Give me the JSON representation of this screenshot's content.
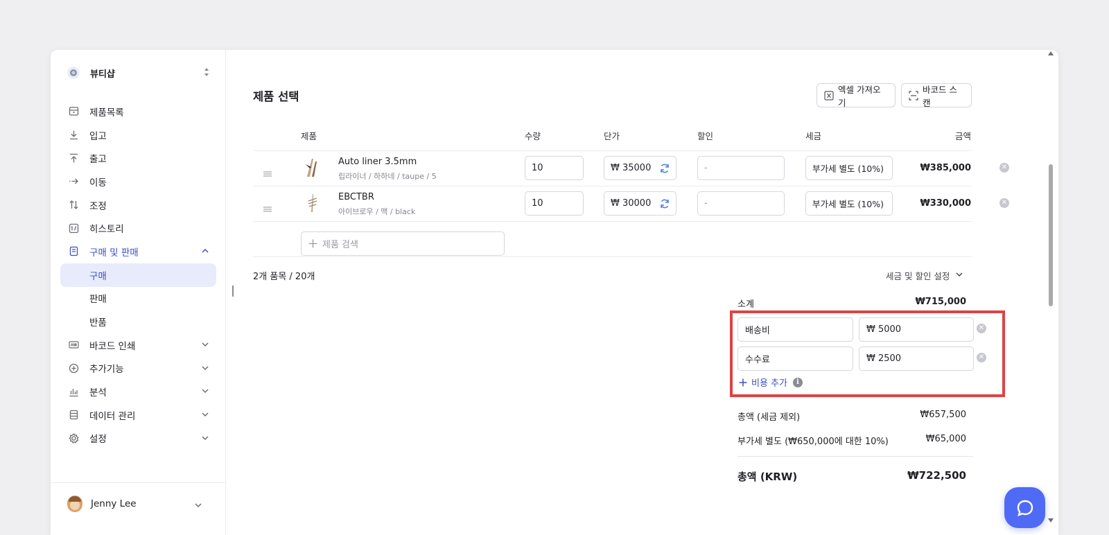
{
  "app": {
    "shop_name": "뷰티샵"
  },
  "sidebar": {
    "items": [
      {
        "label": "제품목록",
        "icon": "box-icon"
      },
      {
        "label": "입고",
        "icon": "download-icon"
      },
      {
        "label": "출고",
        "icon": "upload-icon"
      },
      {
        "label": "이동",
        "icon": "arrow-right-icon"
      },
      {
        "label": "조정",
        "icon": "swap-vertical-icon"
      },
      {
        "label": "히스토리",
        "icon": "history-icon"
      },
      {
        "label": "구매 및 판매",
        "icon": "document-icon",
        "expanded": true
      },
      {
        "label": "구매",
        "selected": true
      },
      {
        "label": "판매"
      },
      {
        "label": "반품"
      },
      {
        "label": "바코드 인쇄",
        "icon": "barcode-icon"
      },
      {
        "label": "추가기능",
        "icon": "plus-circle-icon"
      },
      {
        "label": "분석",
        "icon": "bar-chart-icon"
      },
      {
        "label": "데이터 관리",
        "icon": "database-icon"
      },
      {
        "label": "설정",
        "icon": "gear-icon"
      }
    ],
    "user": {
      "name": "Jenny Lee"
    }
  },
  "main": {
    "title": "제품 선택",
    "excel_button": "엑셀 가져오기",
    "barcode_button": "바코드 스캔",
    "columns": {
      "product": "제품",
      "qty": "수량",
      "unit_price": "단가",
      "discount": "할인",
      "tax": "세금",
      "amount": "금액"
    },
    "rows": [
      {
        "name": "Auto liner 3.5mm",
        "variant": "립라이너 / 하하네 / taupe / 5",
        "qty": "10",
        "price": "₩ 35000",
        "discount": "-",
        "tax": "부가세 별도 (10%)",
        "amount": "₩385,000"
      },
      {
        "name": "EBCTBR",
        "variant": "아이브로우 / 맥 / black",
        "qty": "10",
        "price": "₩ 30000",
        "discount": "-",
        "tax": "부가세 별도 (10%)",
        "amount": "₩330,000"
      }
    ],
    "search_placeholder": "제품 검색",
    "items_summary": "2개 품목 / 20개",
    "tax_discount_settings": "세금 및 할인 설정",
    "subtotal_label": "소계",
    "subtotal_value": "₩715,000",
    "fees": [
      {
        "name": "배송비",
        "amount": "₩ 5000"
      },
      {
        "name": "수수료",
        "amount": "₩ 2500"
      }
    ],
    "add_fee_label": "비용 추가",
    "total_excl_tax_label": "총액 (세금 제외)",
    "total_excl_tax_value": "₩657,500",
    "vat_label": "부가세 별도 (₩650,000에 대한 10%)",
    "vat_value": "₩65,000",
    "grand_total_label": "총액 (KRW)",
    "grand_total_value": "₩722,500"
  },
  "colors": {
    "accent": "#3d4fc2",
    "selected_bg": "#e8ebfb",
    "highlight_border": "#dd4343",
    "chat_button": "#4f6bf5"
  }
}
